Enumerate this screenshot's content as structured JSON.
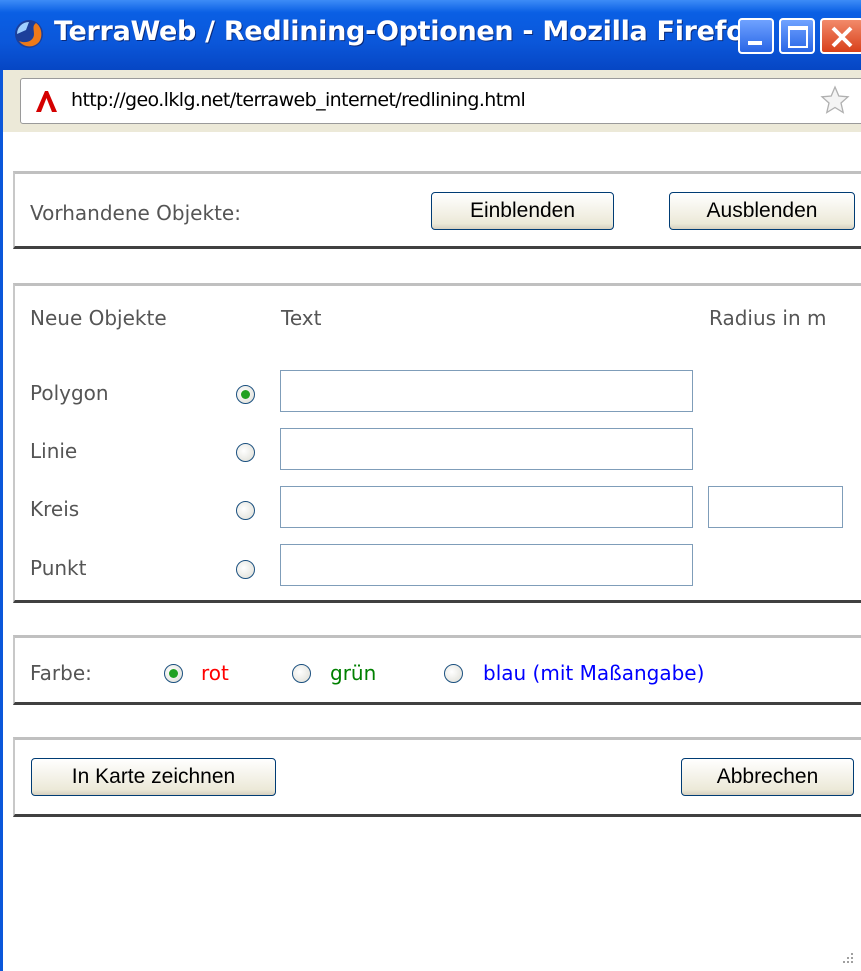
{
  "window": {
    "title": "TerraWeb / Redlining-Optionen - Mozilla Firefox"
  },
  "address": {
    "url": "http://geo.lklg.net/terraweb_internet/redlining.html"
  },
  "existing": {
    "label": "Vorhandene Objekte:",
    "show_button": "Einblenden",
    "hide_button": "Ausblenden"
  },
  "new_objects": {
    "header_label": "Neue Objekte",
    "text_header": "Text",
    "radius_header": "Radius in m",
    "types": [
      {
        "label": "Polygon",
        "checked": true,
        "text_value": ""
      },
      {
        "label": "Linie",
        "checked": false,
        "text_value": ""
      },
      {
        "label": "Kreis",
        "checked": false,
        "text_value": "",
        "radius_value": ""
      },
      {
        "label": "Punkt",
        "checked": false,
        "text_value": ""
      }
    ]
  },
  "color": {
    "label": "Farbe:",
    "options": [
      {
        "label": "rot",
        "color": "#ff0000",
        "checked": true
      },
      {
        "label": "grün",
        "color": "#008000",
        "checked": false
      },
      {
        "label": "blau (mit Maßangabe)",
        "color": "#0000ff",
        "checked": false
      }
    ]
  },
  "actions": {
    "draw_button": "In Karte zeichnen",
    "cancel_button": "Abbrechen"
  }
}
